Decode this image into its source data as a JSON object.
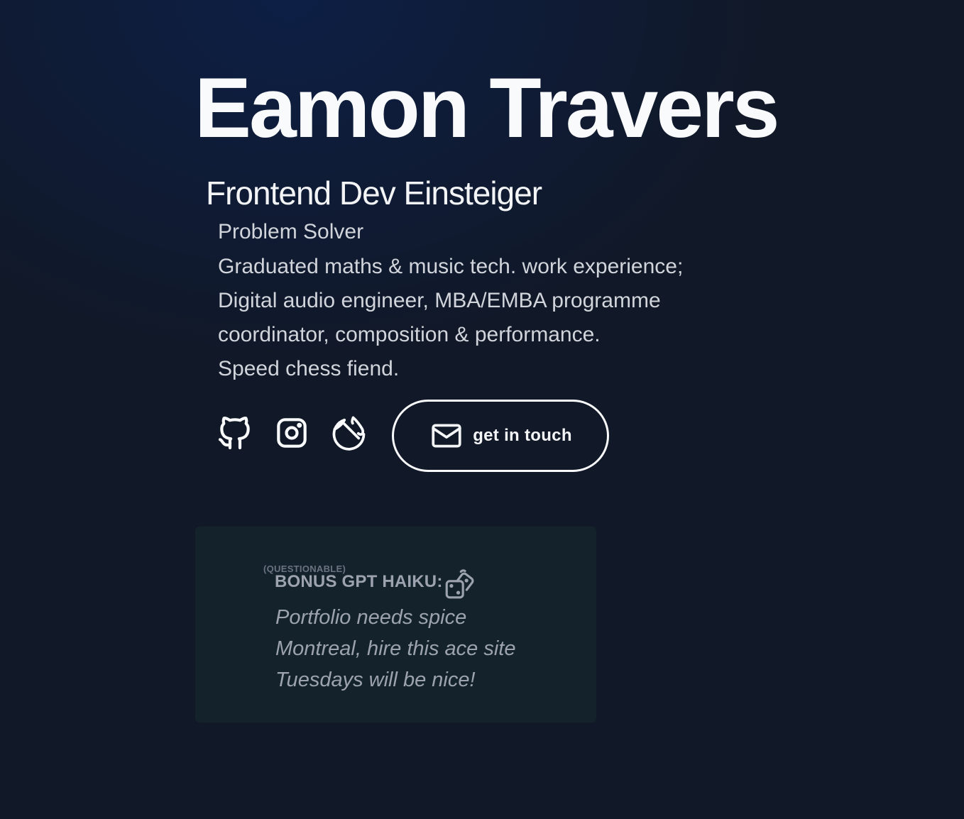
{
  "hero": {
    "name": "Eamon Travers",
    "role": "Frontend Dev Einsteiger",
    "tagline": "Problem Solver",
    "bio_lines": [
      "Graduated maths & music tech. work experience;",
      "Digital audio engineer, MBA/EMBA programme",
      "coordinator, composition & performance.",
      "Speed chess fiend."
    ]
  },
  "social": {
    "links": [
      {
        "icon": "github-icon"
      },
      {
        "icon": "instagram-icon"
      },
      {
        "icon": "lichess-icon"
      }
    ],
    "contact": {
      "icon": "mail-icon",
      "label": "get in touch"
    }
  },
  "haiku": {
    "kicker": "(QUESTIONABLE)",
    "heading": "BONUS GPT HAIKU:",
    "refresh_icon": "dice-icon",
    "lines": [
      "Portfolio needs spice",
      "Montreal, hire this ace site",
      "Tuesdays will be nice!"
    ]
  },
  "colors": {
    "background": "#111827",
    "background_glow": "#0d1f45",
    "card": "#13222b",
    "text_primary": "#f9fafb",
    "text_secondary": "#d1d5db",
    "text_muted": "#9ca3af"
  }
}
